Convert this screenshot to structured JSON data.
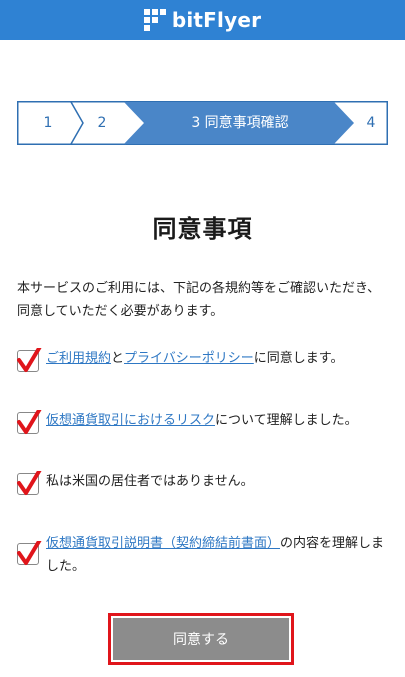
{
  "header": {
    "brand": "bitFlyer"
  },
  "stepper": {
    "steps": [
      {
        "label": "1"
      },
      {
        "label": "2"
      },
      {
        "label": "3 同意事項確認"
      },
      {
        "label": "4"
      }
    ],
    "active_index": 2,
    "colors": {
      "active": "#4a86c8",
      "border": "#2f6fb2"
    }
  },
  "main": {
    "title": "同意事項",
    "intro": "本サービスのご利用には、下記の各規約等をご確認いただき、同意していただく必要があります。"
  },
  "agreements": [
    {
      "link1": "ご利用規約",
      "sep": "と",
      "link2": "プライバシーポリシー",
      "suffix": "に同意します。",
      "checked": true
    },
    {
      "link": "仮想通貨取引におけるリスク",
      "suffix": "について理解しました。",
      "checked": true
    },
    {
      "text": "私は米国の居住者ではありません。",
      "checked": true
    },
    {
      "link": "仮想通貨取引説明書（契約締結前書面）",
      "suffix": "の内容を理解しました。",
      "checked": true
    }
  ],
  "submit": {
    "label": "同意する"
  },
  "colors": {
    "brand": "#2f82d3",
    "link": "#2f78c4",
    "check": "#e0151b",
    "button": "#8c8c8c"
  }
}
